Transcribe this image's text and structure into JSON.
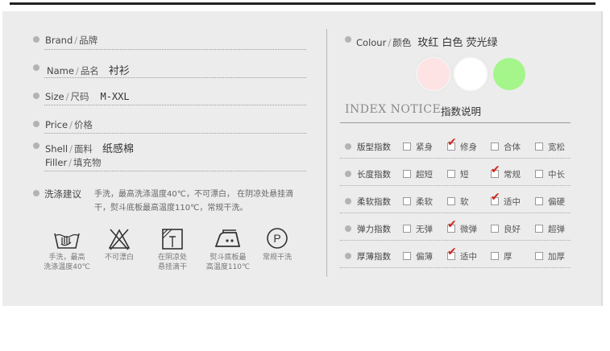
{
  "left": {
    "brand": {
      "en": "Brand",
      "cn": "品牌"
    },
    "name": {
      "en": "Name",
      "cn": "品名",
      "value": "衬衫"
    },
    "size": {
      "en": "Size",
      "cn": "尺码",
      "value": "M-XXL"
    },
    "price": {
      "en": "Price",
      "cn": "价格"
    },
    "shell": {
      "en": "Shell",
      "cn": "面料",
      "value": "纸感棉"
    },
    "filler": {
      "en": "Filler",
      "cn": "填充物"
    },
    "care": {
      "label": "洗涤建议",
      "text": "手洗，最高洗涤温度40℃，不可漂白， 在阴凉处悬挂滴干，熨斗底板最高温度110℃，常规干洗。"
    },
    "wash_icons": [
      {
        "icon": "hand-wash-icon",
        "line1": "手洗，最高",
        "line2": "洗涤温度40℃"
      },
      {
        "icon": "no-bleach-icon",
        "line1": "不可漂白",
        "line2": ""
      },
      {
        "icon": "drip-dry-shade-icon",
        "line1": "在阴凉处",
        "line2": "悬挂滴干"
      },
      {
        "icon": "iron-icon",
        "line1": "熨斗底板最",
        "line2": "高温度110℃"
      },
      {
        "icon": "dry-clean-icon",
        "line1": "常规干洗",
        "line2": ""
      }
    ],
    "dry_clean_symbol": "P"
  },
  "right": {
    "colour": {
      "en": "Colour",
      "cn": "颜色",
      "values": "玫红  白色  荧光绿"
    },
    "swatches": [
      "#fde3e3",
      "#ffffff",
      "#a4f58a"
    ],
    "index_title": "INDEX NOTICE",
    "index_cn": "指数说明",
    "index_rows": [
      {
        "label": "版型指数",
        "options": [
          "紧身",
          "修身",
          "合体",
          "宽松"
        ],
        "selected": 1
      },
      {
        "label": "长度指数",
        "options": [
          "超短",
          "短",
          "常规",
          "中长"
        ],
        "selected": 2
      },
      {
        "label": "柔软指数",
        "options": [
          "柔软",
          "软",
          "适中",
          "偏硬"
        ],
        "selected": 2
      },
      {
        "label": "弹力指数",
        "options": [
          "无弹",
          "微弹",
          "良好",
          "超弹"
        ],
        "selected": 1
      },
      {
        "label": "厚薄指数",
        "options": [
          "偏薄",
          "适中",
          "厚",
          "加厚"
        ],
        "selected": 1
      }
    ]
  }
}
